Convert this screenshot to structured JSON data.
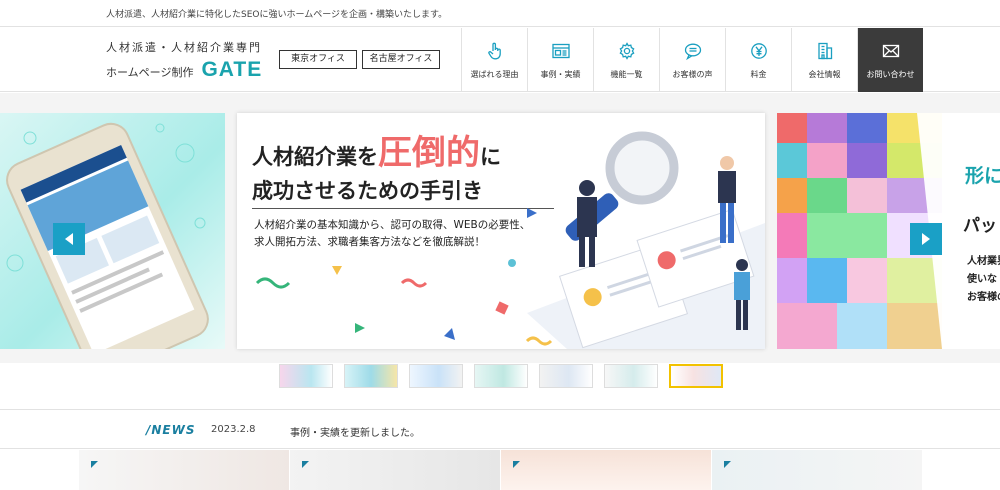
{
  "topbar": {
    "tagline": "人材派遣、人材紹介業に特化したSEOに強いホームページを企画・構築いたします。"
  },
  "logo": {
    "line1": "人材派遣・人材紹介業専門",
    "line2": "ホームページ制作",
    "brand": "GATE"
  },
  "offices": {
    "tokyo": "東京オフィス",
    "nagoya": "名古屋オフィス"
  },
  "nav": {
    "items": [
      {
        "label": "選ばれる理由",
        "icon": "pointer-hand-icon"
      },
      {
        "label": "事例・実績",
        "icon": "browser-window-icon"
      },
      {
        "label": "機能一覧",
        "icon": "gear-icon"
      },
      {
        "label": "お客様の声",
        "icon": "speech-bubble-icon"
      },
      {
        "label": "料金",
        "icon": "yen-icon"
      },
      {
        "label": "会社情報",
        "icon": "building-icon"
      },
      {
        "label": "お問い合わせ",
        "icon": "mail-icon"
      }
    ]
  },
  "hero": {
    "title_pre": "人材紹介業を",
    "title_accent": "圧倒的",
    "title_post": "に",
    "title_line2": "成功させるための手引き",
    "desc_line1": "人材紹介業の基本知識から、認可の取得、WEBの必要性、",
    "desc_line2": "求人開拓方法、求職者集客方法などを徹底解説！"
  },
  "slide_right": {
    "text1": "形に",
    "text2": "パッ",
    "line1": "人材業界",
    "line2": "使いな",
    "line3": "お客様の"
  },
  "news": {
    "heading": "/NEWS",
    "date": "2023.2.8",
    "text": "事例・実績を更新しました。"
  },
  "colors": {
    "brand": "#1aa3ad",
    "accent_red": "#ef6a6a",
    "arrow_blue": "#1aa0c6",
    "nav_dark": "#3b3b3b",
    "thumb_active": "#f2c200"
  },
  "thumbnails": {
    "count": 7,
    "active_index": 6
  }
}
